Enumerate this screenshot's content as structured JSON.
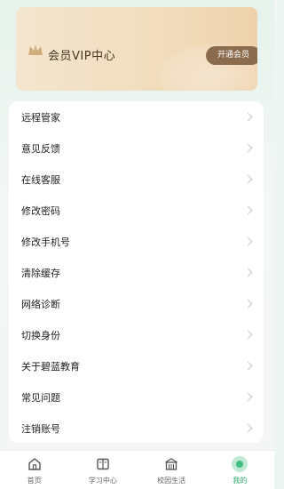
{
  "vip": {
    "title": "会员VIP中心",
    "button": "开通会员"
  },
  "menu": {
    "items": [
      {
        "label": "远程管家"
      },
      {
        "label": "意见反馈"
      },
      {
        "label": "在线客服"
      },
      {
        "label": "修改密码"
      },
      {
        "label": "修改手机号"
      },
      {
        "label": "清除缓存"
      },
      {
        "label": "网络诊断"
      },
      {
        "label": "切换身份"
      },
      {
        "label": "关于碧蓝教育"
      },
      {
        "label": "常见问题"
      },
      {
        "label": "注销账号"
      }
    ]
  },
  "nav": {
    "items": [
      {
        "label": "首页",
        "icon": "home-icon"
      },
      {
        "label": "学习中心",
        "icon": "book-icon"
      },
      {
        "label": "校园生活",
        "icon": "school-icon"
      },
      {
        "label": "我的",
        "icon": "profile-icon"
      }
    ],
    "active_color": "#2fa86f"
  }
}
